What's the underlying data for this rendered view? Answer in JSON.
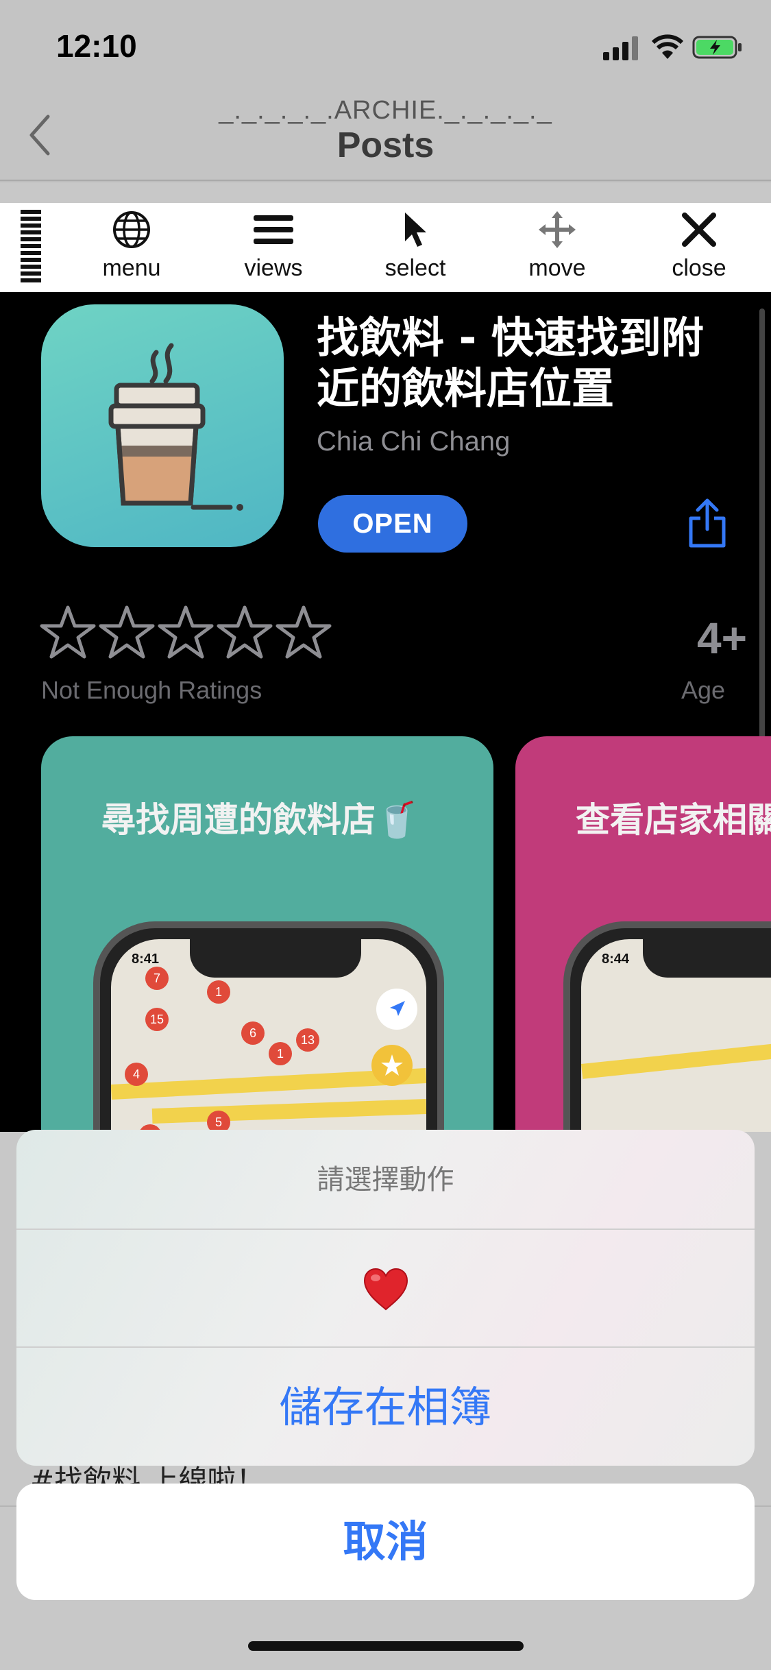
{
  "status_bar": {
    "time": "12:10"
  },
  "nav": {
    "subtitle": "_._._._._.ARCHIE._._._._._",
    "title": "Posts"
  },
  "toolbar": {
    "items": [
      {
        "label": "menu",
        "icon": "globe-icon"
      },
      {
        "label": "views",
        "icon": "hamburger-icon"
      },
      {
        "label": "select",
        "icon": "cursor-icon"
      },
      {
        "label": "move",
        "icon": "move-arrows-icon"
      },
      {
        "label": "close",
        "icon": "close-icon"
      }
    ]
  },
  "app": {
    "title": "找飲料 - 快速找到附近的飲料店位置",
    "developer": "Chia Chi Chang",
    "open_label": "OPEN",
    "ratings_text": "Not Enough Ratings",
    "stars": 0,
    "age_value": "4+",
    "age_label": "Age",
    "screenshots": [
      {
        "caption": "尋找周遭的飲料店🥤",
        "color": "#52ad9e",
        "phone_time": "8:41"
      },
      {
        "caption": "查看店家相關",
        "color": "#c13b7a",
        "phone_time": "8:44"
      }
    ]
  },
  "post": {
    "caption": "#找飲料 上線啦！"
  },
  "action_sheet": {
    "title": "請選擇動作",
    "heart_icon": "heart-icon",
    "save_label": "儲存在相簿",
    "cancel_label": "取消"
  },
  "colors": {
    "accent": "#3478f6",
    "open_button": "#2f6fe0"
  }
}
